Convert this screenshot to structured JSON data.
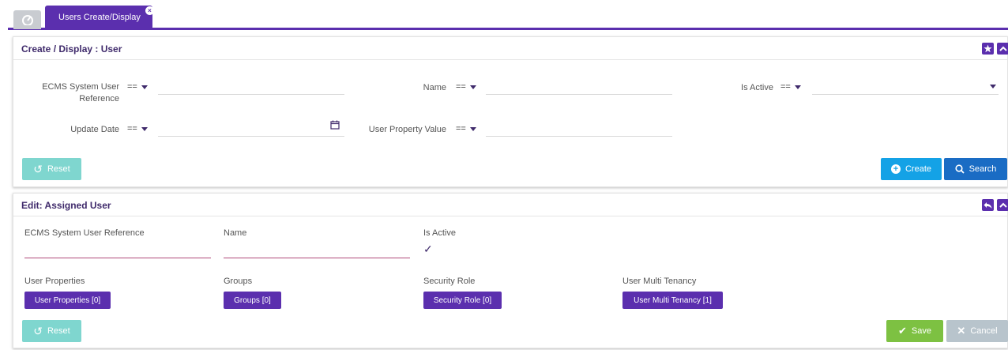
{
  "tabs": {
    "home_icon": "dashboard-icon",
    "active_label": "Users Create/Display"
  },
  "search_panel": {
    "title": "Create / Display : User",
    "fields": {
      "ecms_ref_label": "ECMS System User Reference",
      "name_label": "Name",
      "is_active_label": "Is Active",
      "update_date_label": "Update Date",
      "user_property_value_label": "User Property Value",
      "operator": "=="
    },
    "buttons": {
      "reset": "Reset",
      "create": "Create",
      "search": "Search"
    }
  },
  "edit_panel": {
    "title": "Edit: Assigned User",
    "fields": {
      "ecms_ref_label": "ECMS System User Reference",
      "name_label": "Name",
      "is_active_label": "Is Active",
      "is_active_value": "✓"
    },
    "sections": {
      "user_properties_label": "User Properties",
      "user_properties_button": "User Properties [0]",
      "groups_label": "Groups",
      "groups_button": "Groups [0]",
      "security_role_label": "Security Role",
      "security_role_button": "Security Role [0]",
      "multi_tenancy_label": "User Multi Tenancy",
      "multi_tenancy_button": "User Multi Tenancy [1]"
    },
    "buttons": {
      "reset": "Reset",
      "save": "Save",
      "cancel": "Cancel"
    }
  },
  "colors": {
    "accent": "#5b2fae",
    "create": "#14a2e6",
    "search": "#1a6cc4",
    "save": "#7dc142",
    "reset": "#7fd6cf"
  }
}
